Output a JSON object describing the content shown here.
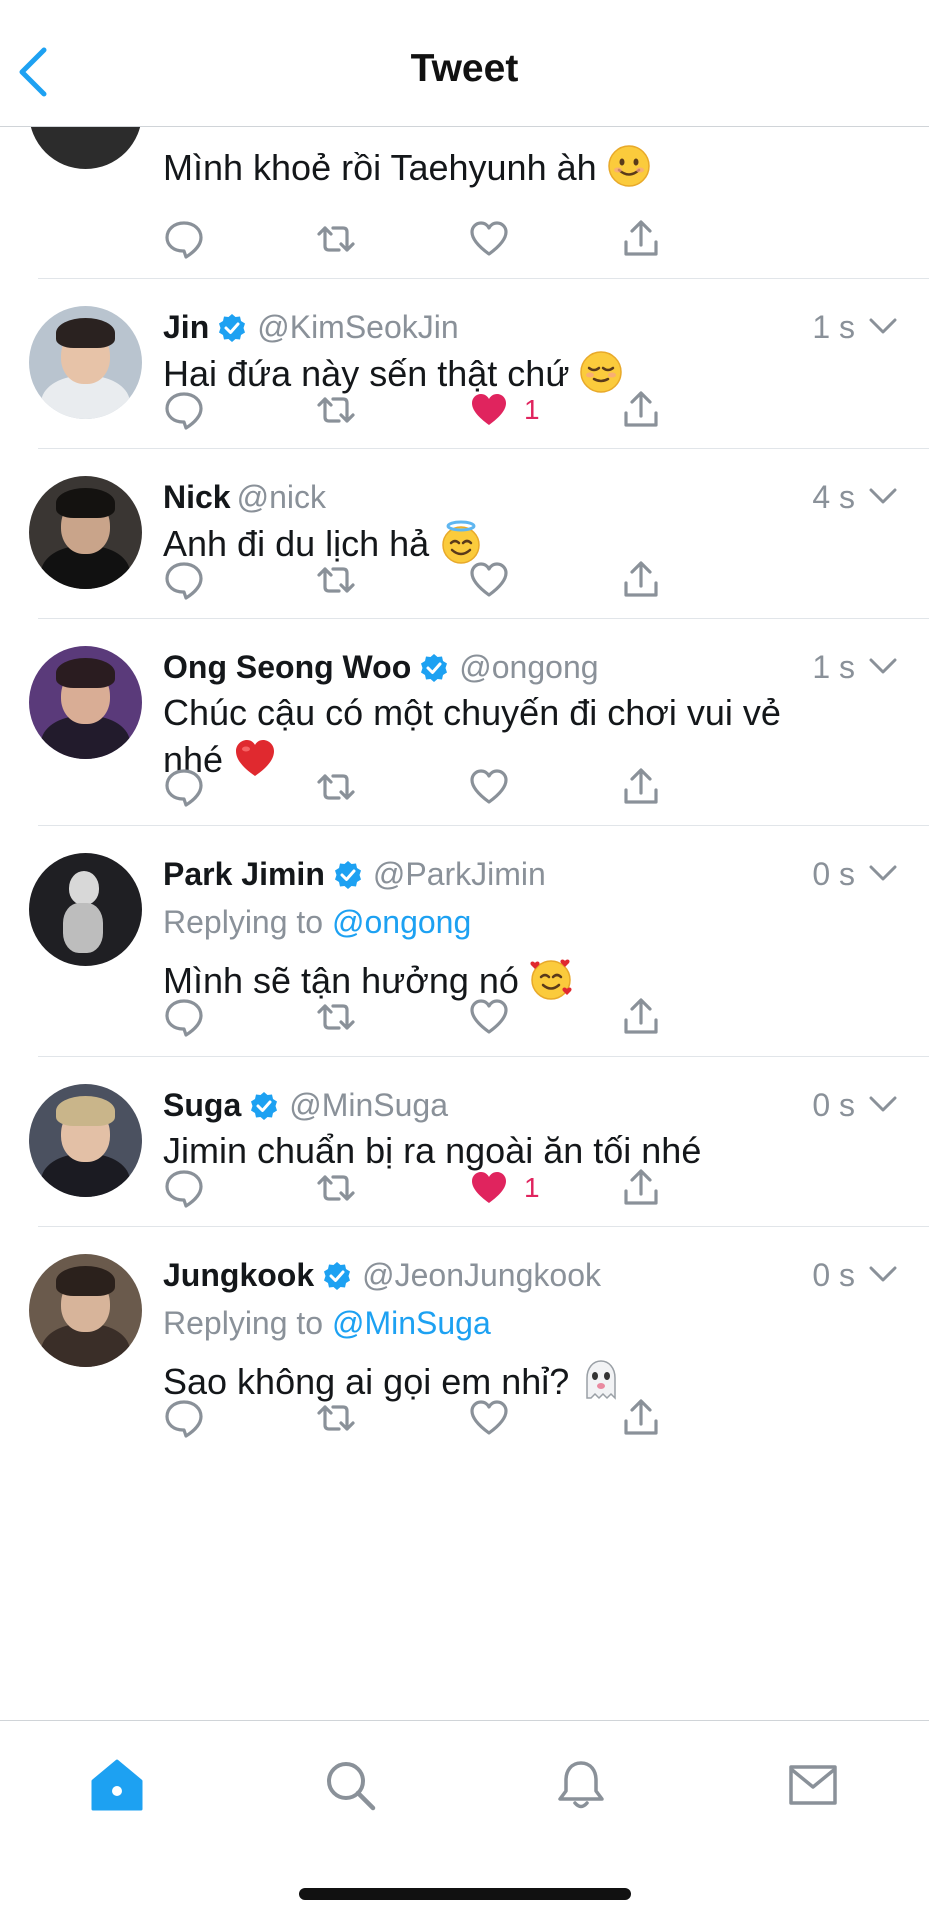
{
  "header": {
    "title": "Tweet"
  },
  "colors": {
    "accent": "#1da1f2",
    "like": "#e0245e",
    "muted": "#8a9199",
    "verified": "#1da1f2"
  },
  "tweets": [
    {
      "text": "Mình khoẻ rồi Taehyunh àh",
      "emoji": "slightly-smiling-face-emoji",
      "liked": false
    },
    {
      "name": "Jin",
      "verified": true,
      "handle": "@KimSeokJin",
      "time": "1 s",
      "text": "Hai đứa này sến thật chứ",
      "emoji": "relieved-face-emoji",
      "liked": true,
      "like_count": "1"
    },
    {
      "name": "Nick",
      "verified": false,
      "handle": "@nick",
      "time": "4 s",
      "text": "Anh đi du lịch hả",
      "emoji": "smiling-face-with-halo-emoji",
      "liked": false
    },
    {
      "name": "Ong Seong Woo",
      "verified": true,
      "handle": "@ongong",
      "time": "1 s",
      "text_line1": "Chúc cậu có một chuyến đi chơi vui vẻ",
      "text_line2": "nhé",
      "emoji": "red-heart-emoji",
      "liked": false
    },
    {
      "name": "Park Jimin",
      "verified": true,
      "handle": "@ParkJimin",
      "time": "0 s",
      "replying_prefix": "Replying to",
      "replying_to": "@ongong",
      "text": "Mình sẽ tận hưởng nó",
      "emoji": "smiling-face-with-hearts-emoji",
      "liked": false
    },
    {
      "name": "Suga",
      "verified": true,
      "handle": "@MinSuga",
      "time": "0 s",
      "text": "Jimin chuẩn bị ra ngoài ăn tối nhé",
      "liked": true,
      "like_count": "1"
    },
    {
      "name": "Jungkook",
      "verified": true,
      "handle": "@JeonJungkook",
      "time": "0 s",
      "replying_prefix": "Replying to",
      "replying_to": "@MinSuga",
      "text": "Sao không ai gọi em nhỉ?",
      "emoji": "ghost-emoji",
      "liked": false
    }
  ],
  "tabs": [
    {
      "icon": "home-icon",
      "active": true
    },
    {
      "icon": "search-icon",
      "active": false
    },
    {
      "icon": "bell-icon",
      "active": false
    },
    {
      "icon": "mail-icon",
      "active": false
    }
  ]
}
